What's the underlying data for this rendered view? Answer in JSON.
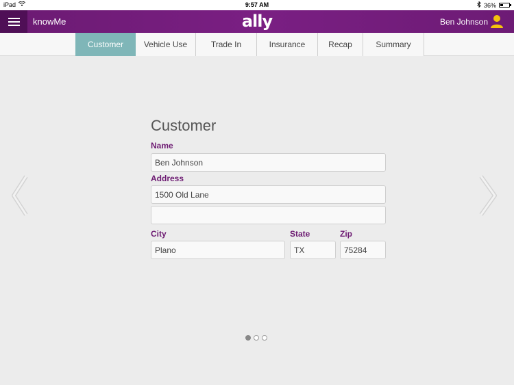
{
  "status_bar": {
    "device": "iPad",
    "time": "9:57 AM",
    "battery": "36%",
    "battery_fill": 0.36
  },
  "header": {
    "app_name": "knowMe",
    "brand": "ally",
    "user_name": "Ben Johnson"
  },
  "tabs": [
    {
      "label": "Customer",
      "active": true
    },
    {
      "label": "Vehicle Use",
      "active": false
    },
    {
      "label": "Trade In",
      "active": false
    },
    {
      "label": "Insurance",
      "active": false
    },
    {
      "label": "Recap",
      "active": false
    },
    {
      "label": "Summary",
      "active": false
    }
  ],
  "form": {
    "title": "Customer",
    "name_label": "Name",
    "name_value": "Ben Johnson",
    "address_label": "Address",
    "address_line1": "1500 Old Lane",
    "address_line2": "",
    "city_label": "City",
    "city_value": "Plano",
    "state_label": "State",
    "state_value": "TX",
    "zip_label": "Zip",
    "zip_value": "75284"
  },
  "pager": {
    "pages": 3,
    "current": 1
  },
  "colors": {
    "header": "#7a1f83",
    "accent_tab": "#7fb6b8",
    "label": "#6d1b72"
  }
}
